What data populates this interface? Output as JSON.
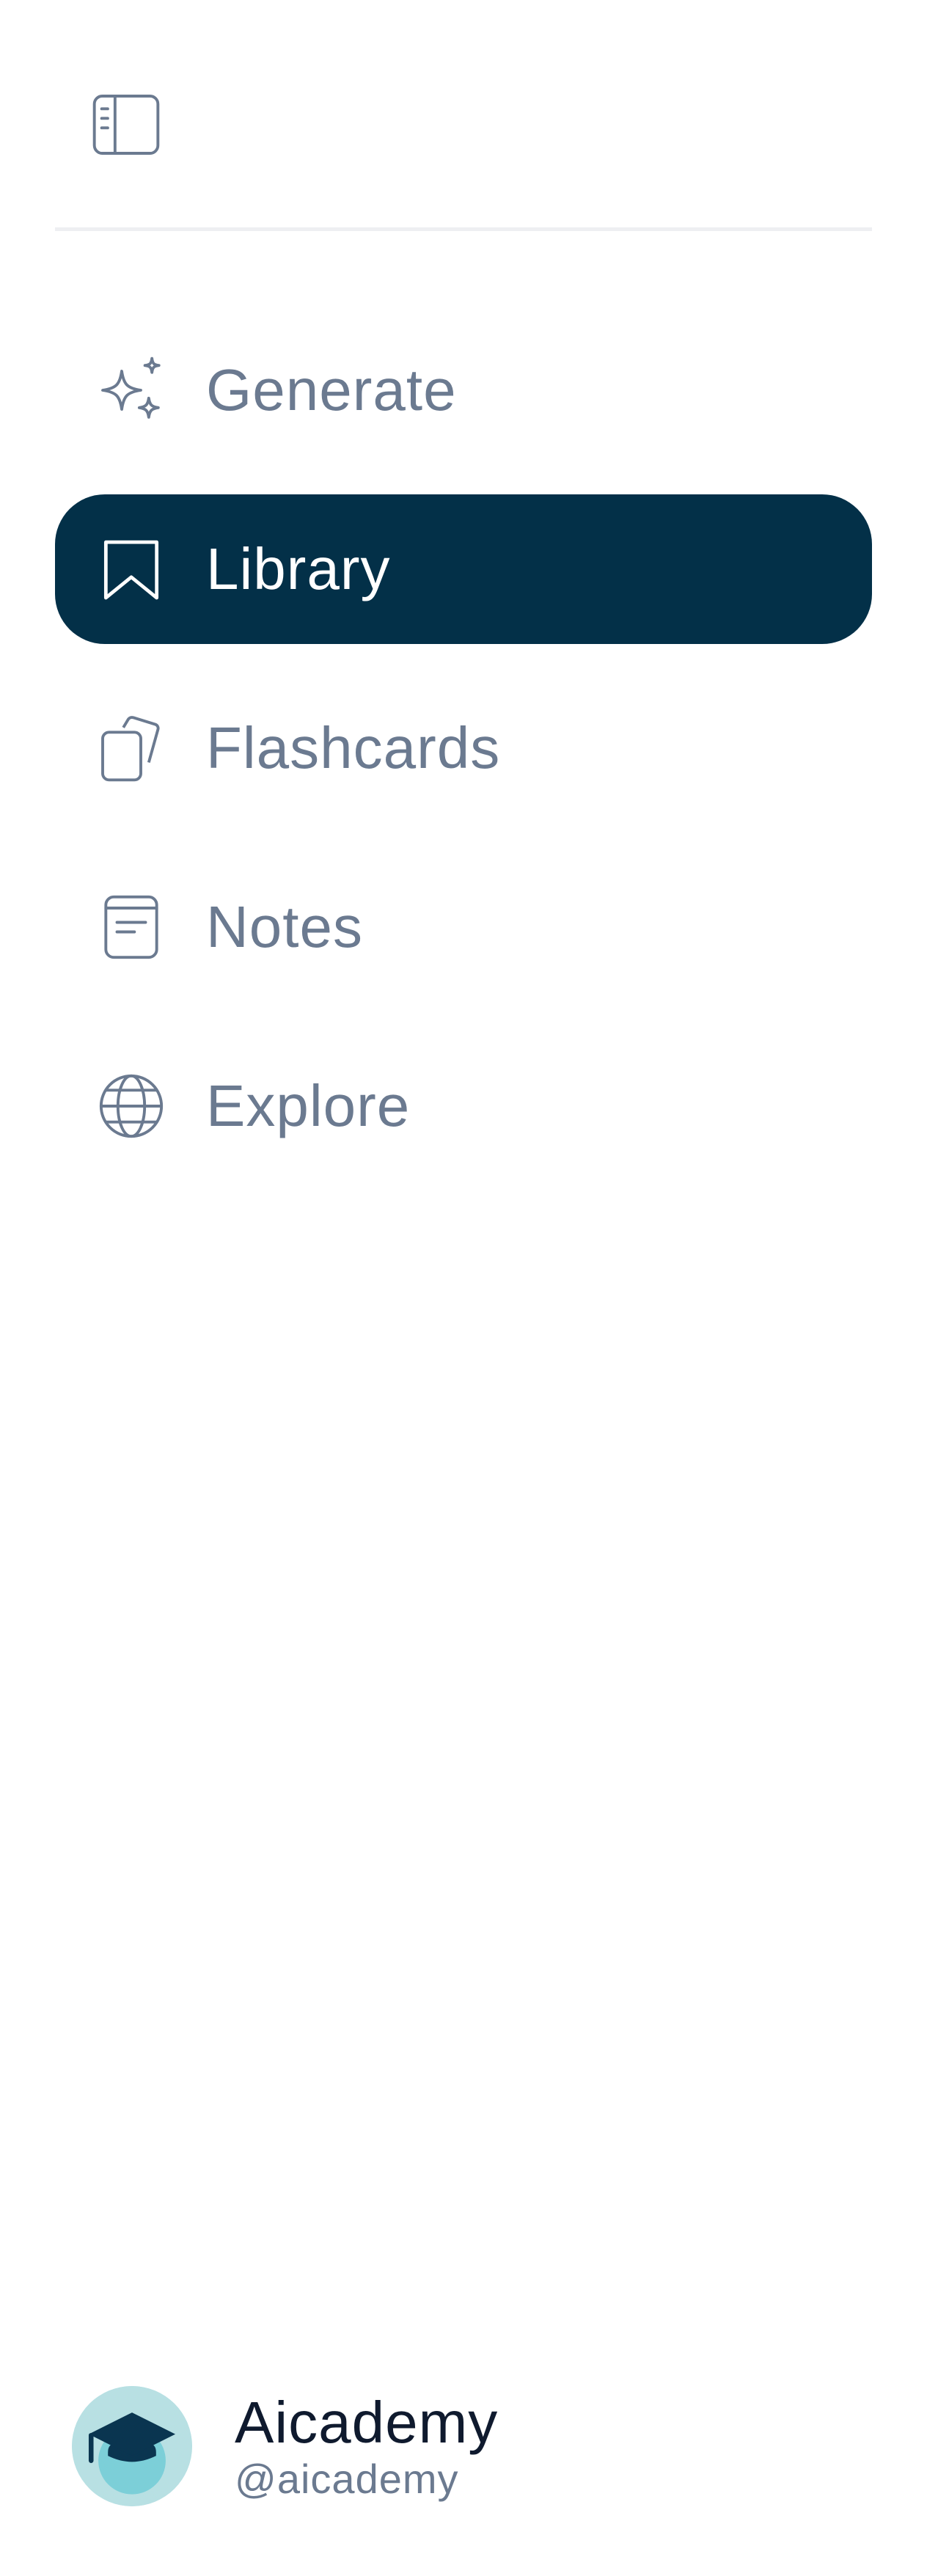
{
  "sidebar": {
    "toggle_icon": "sidebar-toggle-icon",
    "nav": [
      {
        "label": "Generate",
        "icon": "sparkles-icon",
        "active": false
      },
      {
        "label": "Library",
        "icon": "bookmark-icon",
        "active": true
      },
      {
        "label": "Flashcards",
        "icon": "flashcards-icon",
        "active": false
      },
      {
        "label": "Notes",
        "icon": "notes-icon",
        "active": false
      },
      {
        "label": "Explore",
        "icon": "globe-icon",
        "active": false
      }
    ],
    "profile": {
      "name": "Aicademy",
      "handle": "@aicademy",
      "avatar_icon": "graduation-cap-icon"
    }
  },
  "colors": {
    "active_bg": "#033048",
    "active_text": "#ffffff",
    "inactive_text": "#6b7a90",
    "avatar_bg": "#b8e0e3"
  }
}
